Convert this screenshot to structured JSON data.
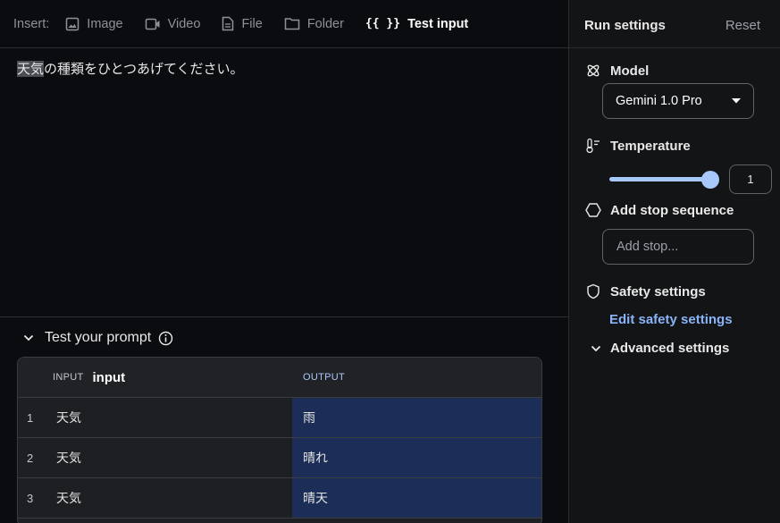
{
  "toolbar": {
    "insert_label": "Insert:",
    "image_label": "Image",
    "video_label": "Video",
    "file_label": "File",
    "folder_label": "Folder",
    "test_input_label": "Test input",
    "test_input_icon_text": "{{ }}"
  },
  "prompt": {
    "highlight": "天気",
    "rest": "の種類をひとつあげてください。"
  },
  "test": {
    "title": "Test your prompt",
    "input_caption": "INPUT",
    "input_var": "input",
    "output_caption": "OUTPUT",
    "rows": [
      {
        "num": "1",
        "input": "天気",
        "output": "雨"
      },
      {
        "num": "2",
        "input": "天気",
        "output": "晴れ"
      },
      {
        "num": "3",
        "input": "天気",
        "output": "晴天"
      }
    ]
  },
  "run_settings": {
    "title": "Run settings",
    "reset": "Reset",
    "model_label": "Model",
    "model_value": "Gemini 1.0 Pro",
    "temperature_label": "Temperature",
    "temperature_value": "1",
    "temperature_fraction": 1.0,
    "stop_label": "Add stop sequence",
    "stop_placeholder": "Add stop...",
    "safety_label": "Safety settings",
    "safety_link": "Edit safety settings",
    "advanced_label": "Advanced settings"
  },
  "colors": {
    "accent": "#a8c7fa",
    "link": "#8ab4f8",
    "output_cell": "#1c2e58"
  }
}
